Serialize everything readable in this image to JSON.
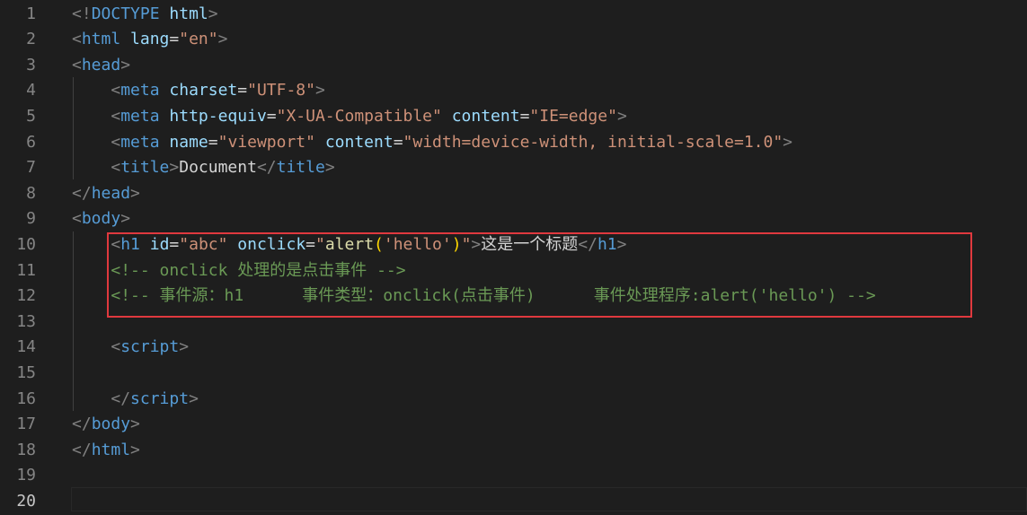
{
  "editor": {
    "language": "HTML",
    "theme_colors": {
      "background": "#1e1e1e",
      "tag": "#569cd6",
      "punctuation": "#808080",
      "attribute": "#9cdcfe",
      "string": "#ce9178",
      "function": "#dcdcaa",
      "bracket": "#ffd700",
      "comment": "#6a9955",
      "text": "#d4d4d4",
      "highlight_box": "#e0393e"
    },
    "active_line": "20",
    "highlighted_lines": [
      "10",
      "11",
      "12"
    ],
    "line_numbers": [
      "1",
      "2",
      "3",
      "4",
      "5",
      "6",
      "7",
      "8",
      "9",
      "10",
      "11",
      "12",
      "13",
      "14",
      "15",
      "16",
      "17",
      "18",
      "19",
      "20"
    ],
    "lines": [
      [
        {
          "t": "punc",
          "v": "<!"
        },
        {
          "t": "tag",
          "v": "DOCTYPE"
        },
        {
          "t": "txt",
          "v": " "
        },
        {
          "t": "attr",
          "v": "html"
        },
        {
          "t": "punc",
          "v": ">"
        }
      ],
      [
        {
          "t": "punc",
          "v": "<"
        },
        {
          "t": "tag",
          "v": "html"
        },
        {
          "t": "txt",
          "v": " "
        },
        {
          "t": "attr",
          "v": "lang"
        },
        {
          "t": "txt",
          "v": "="
        },
        {
          "t": "str",
          "v": "\"en\""
        },
        {
          "t": "punc",
          "v": ">"
        }
      ],
      [
        {
          "t": "punc",
          "v": "<"
        },
        {
          "t": "tag",
          "v": "head"
        },
        {
          "t": "punc",
          "v": ">"
        }
      ],
      [
        {
          "t": "txt",
          "v": "    "
        },
        {
          "t": "punc",
          "v": "<"
        },
        {
          "t": "tag",
          "v": "meta"
        },
        {
          "t": "txt",
          "v": " "
        },
        {
          "t": "attr",
          "v": "charset"
        },
        {
          "t": "txt",
          "v": "="
        },
        {
          "t": "str",
          "v": "\"UTF-8\""
        },
        {
          "t": "punc",
          "v": ">"
        }
      ],
      [
        {
          "t": "txt",
          "v": "    "
        },
        {
          "t": "punc",
          "v": "<"
        },
        {
          "t": "tag",
          "v": "meta"
        },
        {
          "t": "txt",
          "v": " "
        },
        {
          "t": "attr",
          "v": "http-equiv"
        },
        {
          "t": "txt",
          "v": "="
        },
        {
          "t": "str",
          "v": "\"X-UA-Compatible\""
        },
        {
          "t": "txt",
          "v": " "
        },
        {
          "t": "attr",
          "v": "content"
        },
        {
          "t": "txt",
          "v": "="
        },
        {
          "t": "str",
          "v": "\"IE=edge\""
        },
        {
          "t": "punc",
          "v": ">"
        }
      ],
      [
        {
          "t": "txt",
          "v": "    "
        },
        {
          "t": "punc",
          "v": "<"
        },
        {
          "t": "tag",
          "v": "meta"
        },
        {
          "t": "txt",
          "v": " "
        },
        {
          "t": "attr",
          "v": "name"
        },
        {
          "t": "txt",
          "v": "="
        },
        {
          "t": "str",
          "v": "\"viewport\""
        },
        {
          "t": "txt",
          "v": " "
        },
        {
          "t": "attr",
          "v": "content"
        },
        {
          "t": "txt",
          "v": "="
        },
        {
          "t": "str",
          "v": "\"width=device-width, initial-scale=1.0\""
        },
        {
          "t": "punc",
          "v": ">"
        }
      ],
      [
        {
          "t": "txt",
          "v": "    "
        },
        {
          "t": "punc",
          "v": "<"
        },
        {
          "t": "tag",
          "v": "title"
        },
        {
          "t": "punc",
          "v": ">"
        },
        {
          "t": "txt",
          "v": "Document"
        },
        {
          "t": "punc",
          "v": "</"
        },
        {
          "t": "tag",
          "v": "title"
        },
        {
          "t": "punc",
          "v": ">"
        }
      ],
      [
        {
          "t": "punc",
          "v": "</"
        },
        {
          "t": "tag",
          "v": "head"
        },
        {
          "t": "punc",
          "v": ">"
        }
      ],
      [
        {
          "t": "punc",
          "v": "<"
        },
        {
          "t": "tag",
          "v": "body"
        },
        {
          "t": "punc",
          "v": ">"
        }
      ],
      [
        {
          "t": "txt",
          "v": "    "
        },
        {
          "t": "punc",
          "v": "<"
        },
        {
          "t": "tag",
          "v": "h1"
        },
        {
          "t": "txt",
          "v": " "
        },
        {
          "t": "attr",
          "v": "id"
        },
        {
          "t": "txt",
          "v": "="
        },
        {
          "t": "str",
          "v": "\"abc\""
        },
        {
          "t": "txt",
          "v": " "
        },
        {
          "t": "attr",
          "v": "onclick"
        },
        {
          "t": "txt",
          "v": "="
        },
        {
          "t": "str",
          "v": "\""
        },
        {
          "t": "fn",
          "v": "alert"
        },
        {
          "t": "par",
          "v": "("
        },
        {
          "t": "str",
          "v": "'hello'"
        },
        {
          "t": "par",
          "v": ")"
        },
        {
          "t": "str",
          "v": "\""
        },
        {
          "t": "punc",
          "v": ">"
        },
        {
          "t": "txt",
          "v": "这是一个标题"
        },
        {
          "t": "punc",
          "v": "</"
        },
        {
          "t": "tag",
          "v": "h1"
        },
        {
          "t": "punc",
          "v": ">"
        }
      ],
      [
        {
          "t": "txt",
          "v": "    "
        },
        {
          "t": "cmt",
          "v": "<!-- onclick 处理的是点击事件 -->"
        }
      ],
      [
        {
          "t": "txt",
          "v": "    "
        },
        {
          "t": "cmt",
          "v": "<!-- 事件源：h1      事件类型：onclick(点击事件)      事件处理程序:alert('hello') -->"
        }
      ],
      [],
      [
        {
          "t": "txt",
          "v": "    "
        },
        {
          "t": "punc",
          "v": "<"
        },
        {
          "t": "tag",
          "v": "script"
        },
        {
          "t": "punc",
          "v": ">"
        }
      ],
      [],
      [
        {
          "t": "txt",
          "v": "    "
        },
        {
          "t": "punc",
          "v": "</"
        },
        {
          "t": "tag",
          "v": "script"
        },
        {
          "t": "punc",
          "v": ">"
        }
      ],
      [
        {
          "t": "punc",
          "v": "</"
        },
        {
          "t": "tag",
          "v": "body"
        },
        {
          "t": "punc",
          "v": ">"
        }
      ],
      [
        {
          "t": "punc",
          "v": "</"
        },
        {
          "t": "tag",
          "v": "html"
        },
        {
          "t": "punc",
          "v": ">"
        }
      ],
      [],
      []
    ]
  }
}
